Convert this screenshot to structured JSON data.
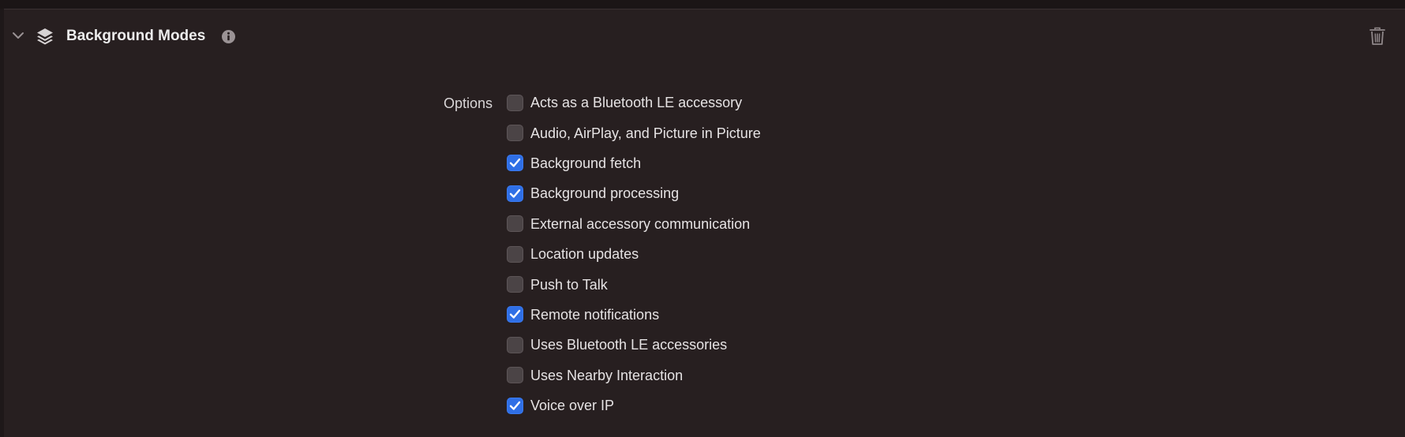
{
  "section": {
    "title": "Background Modes",
    "icons": {
      "disclosure": "chevron-down-icon",
      "capability": "layers-icon",
      "info": "info-icon",
      "delete": "trash-icon"
    }
  },
  "options": {
    "label": "Options",
    "items": [
      {
        "label": "Acts as a Bluetooth LE accessory",
        "checked": false
      },
      {
        "label": "Audio, AirPlay, and Picture in Picture",
        "checked": false
      },
      {
        "label": "Background fetch",
        "checked": true
      },
      {
        "label": "Background processing",
        "checked": true
      },
      {
        "label": "External accessory communication",
        "checked": false
      },
      {
        "label": "Location updates",
        "checked": false
      },
      {
        "label": "Push to Talk",
        "checked": false
      },
      {
        "label": "Remote notifications",
        "checked": true
      },
      {
        "label": "Uses Bluetooth LE accessories",
        "checked": false
      },
      {
        "label": "Uses Nearby Interaction",
        "checked": false
      },
      {
        "label": "Voice over IP",
        "checked": true
      }
    ]
  },
  "colors": {
    "background": "#271f20",
    "checkbox_checked": "#2f6fe6",
    "checkbox_unchecked": "#4b4446",
    "text": "#e6e3e4"
  }
}
